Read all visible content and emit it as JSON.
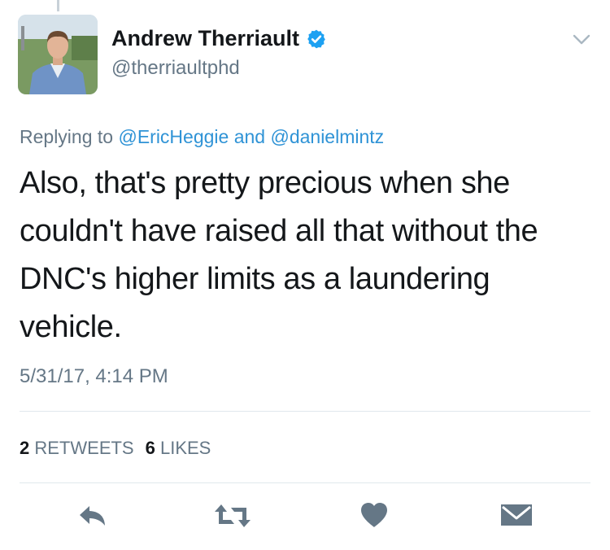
{
  "author": {
    "display_name": "Andrew Therriault",
    "handle": "@therriaultphd",
    "verified": true
  },
  "reply": {
    "prefix": "Replying to",
    "mention_1": "@EricHeggie",
    "conjunction": "and",
    "mention_2": "@danielmintz"
  },
  "tweet": {
    "text": "Also, that's pretty precious when she couldn't have raised all that without the DNC's higher limits as a laundering vehicle.",
    "timestamp": "5/31/17, 4:14 PM"
  },
  "stats": {
    "retweets_count": "2",
    "retweets_label": "RETWEETS",
    "likes_count": "6",
    "likes_label": "LIKES"
  },
  "icons": {
    "verified": "verified-badge-icon",
    "more": "chevron-down-icon",
    "reply": "reply-icon",
    "retweet": "retweet-icon",
    "like": "heart-icon",
    "message": "envelope-icon"
  },
  "colors": {
    "link": "#2f93d6",
    "secondary_text": "#657786",
    "primary_text": "#14171a",
    "action_icon": "#657786",
    "verified": "#1da1f2"
  }
}
